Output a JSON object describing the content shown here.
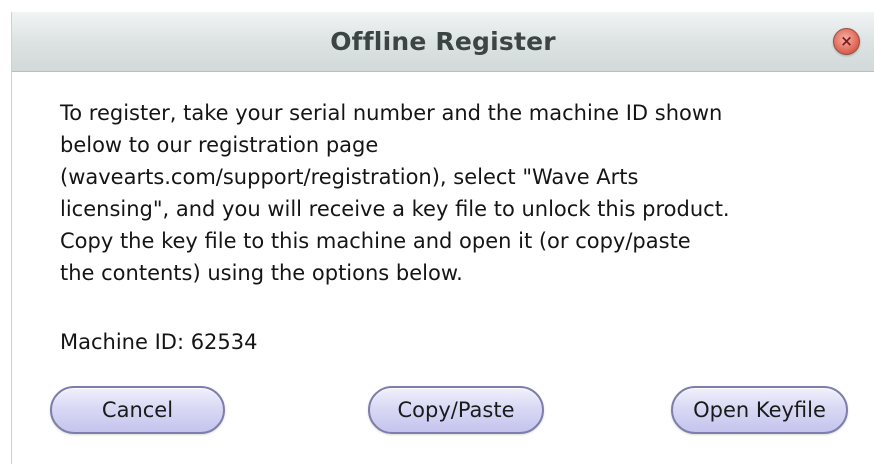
{
  "dialog": {
    "title": "Offline Register",
    "close_symbol": "×",
    "close_icon": "close-icon",
    "message_lines": [
      "To register, take your serial number and the machine ID shown",
      "below to our registration page",
      "(wavearts.com/support/registration), select \"Wave Arts",
      "licensing\", and you will receive a key file to unlock this product.",
      "Copy the key file to this machine and open it (or copy/paste",
      "the contents) using the options below."
    ],
    "machine_id_text": "Machine ID: 62534"
  },
  "buttons": {
    "cancel": "Cancel",
    "copy_paste": "Copy/Paste",
    "open_keyfile": "Open Keyfile"
  },
  "colors": {
    "titlebar": "#dde3e3",
    "close_button": "#e2705f",
    "button_fill": "#d9d9f5",
    "button_border": "#7e7eaa"
  }
}
